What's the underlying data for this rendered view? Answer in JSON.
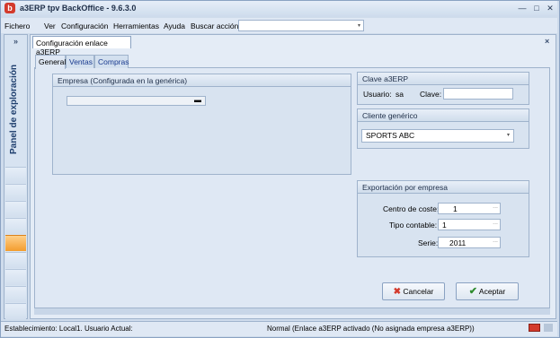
{
  "window": {
    "app_logo": "b",
    "title": "a3ERP tpv BackOffice - 9.6.3.0",
    "controls": {
      "minimize": "—",
      "maximize": "□",
      "close": "✕"
    }
  },
  "menu": {
    "items": [
      "Fichero",
      "Ver",
      "Configuración",
      "Herramientas",
      "Ayuda",
      "Buscar acción"
    ],
    "search_value": "",
    "search_arrow": "▾"
  },
  "sidebar": {
    "toggle": "»",
    "label": "Panel de exploración"
  },
  "document": {
    "tab_label": "Configuración enlace  a3ERP",
    "close": "×"
  },
  "tabs": [
    "General",
    "Ventas",
    "Compras"
  ],
  "empresa": {
    "title": "Empresa (Configurada en la genérica)",
    "value": "",
    "marker": "▬"
  },
  "clave": {
    "title": "Clave a3ERP",
    "usuario_label": "Usuario:",
    "usuario_value": "sa",
    "clave_label": "Clave:",
    "clave_value": ""
  },
  "cliente": {
    "title": "Cliente genérico",
    "value": "SPORTS ABC",
    "arrow": "▾"
  },
  "exportacion": {
    "title": "Exportación por empresa",
    "centro_label": "Centro de coste:",
    "centro_value": "1",
    "tipo_label": "Tipo contable:",
    "tipo_value": "1",
    "serie_label": "Serie:",
    "serie_value": "2011",
    "ellipsis": "..."
  },
  "buttons": {
    "cancel_label": "Cancelar",
    "accept_label": "Aceptar"
  },
  "status": {
    "left": "Establecimiento: Local1.   Usuario Actual:",
    "center": "Normal (Enlace a3ERP activado (No asignada empresa a3ERP))"
  },
  "colors": {
    "accent": "#d33a2c",
    "panel_bg": "#dfe8f4",
    "border": "#9fb3cc",
    "highlight": "#f39c2e"
  }
}
